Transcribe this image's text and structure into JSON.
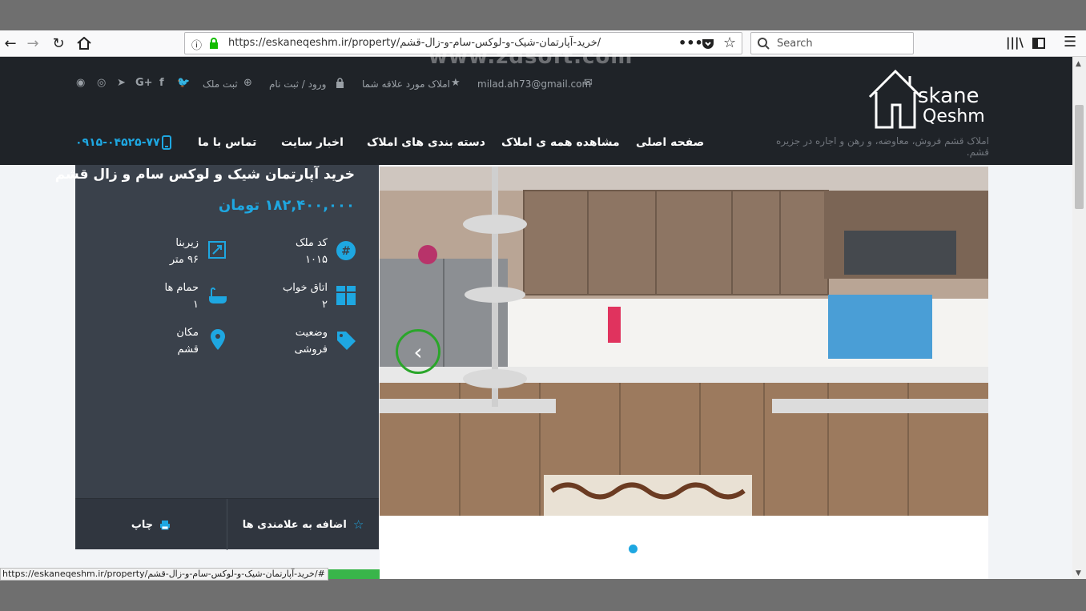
{
  "browser": {
    "url": "https://eskaneqeshm.ir/property/خرید-آپارتمان-شیک-و-لوکس-سام-و-زال-قشم/",
    "search_placeholder": "Search",
    "status_url": "https://eskaneqeshm.ir/property/خرید-آپارتمان-شیک-و-لوکس-سام-و-زال-قشم/#",
    "watermark": "www.zdsoft.com"
  },
  "topbar": {
    "email": "milad.ah73@gmail.com",
    "favorites": "املاک مورد علاقه شما",
    "login": "ورود / ثبت نام",
    "add_property": "ثبت ملک"
  },
  "logo": {
    "line1": "skane",
    "line2": "Qeshm"
  },
  "nav": {
    "home": "صفحه اصلی",
    "all_properties": "مشاهده همه ی املاک",
    "categories": "دسته بندی های املاک",
    "news": "اخبار سایت",
    "contact": "تماس با ما",
    "phone": "۰۹۱۵-۰۴۵۲۵-۷۷",
    "tagline": "املاک قشم فروش، معاوضه، و رهن و اجاره در جزیره قشم."
  },
  "property": {
    "title": "خرید آپارتمان شیک و لوکس سام و زال قشم",
    "price": "۱۸۲,۴۰۰,۰۰۰ تومان",
    "fields": {
      "code_label": "کد ملک",
      "code_value": "۱۰۱۵",
      "area_label": "زیربنا",
      "area_value": "۹۶ متر",
      "bedrooms_label": "اتاق خواب",
      "bedrooms_value": "۲",
      "bathrooms_label": "حمام ها",
      "bathrooms_value": "۱",
      "status_label": "وضعیت",
      "status_value": "فروشی",
      "location_label": "مکان",
      "location_value": "قشم"
    },
    "bookmark": "اضافه به علامندی ها",
    "print": "چاپ"
  },
  "colors": {
    "accent": "#1ea7e1",
    "header_bg": "#1f2328",
    "card_bg": "#3a414b"
  }
}
